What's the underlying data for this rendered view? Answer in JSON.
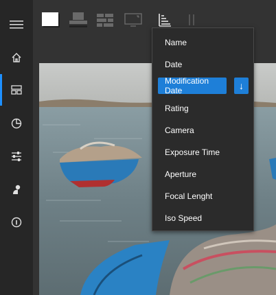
{
  "sidebar": {
    "items": [
      {
        "icon": "hamburger-menu-icon"
      },
      {
        "icon": "home-icon"
      },
      {
        "icon": "gallery-grid-icon",
        "active": true
      },
      {
        "icon": "pie-chart-icon"
      },
      {
        "icon": "sliders-icon"
      },
      {
        "icon": "person-icon"
      },
      {
        "icon": "info-icon"
      }
    ],
    "accent_color": "#1e90ff"
  },
  "toolbar": {
    "buttons": [
      {
        "icon": "single-view-icon"
      },
      {
        "icon": "stacked-view-icon"
      },
      {
        "icon": "brick-grid-view-icon"
      },
      {
        "icon": "fullscreen-monitor-icon"
      },
      {
        "icon": "sort-icon"
      },
      {
        "icon": "pause-icon"
      }
    ]
  },
  "sort_menu": {
    "items": [
      {
        "label": "Name"
      },
      {
        "label": "Date"
      },
      {
        "label": "Modification Date",
        "selected": true
      },
      {
        "label": "Rating"
      },
      {
        "label": "Camera"
      },
      {
        "label": "Exposure Time"
      },
      {
        "label": "Aperture"
      },
      {
        "label": "Focal Lenght"
      },
      {
        "label": "Iso Speed"
      }
    ],
    "direction_symbol": "↓",
    "selection_color": "#1e7fd8"
  }
}
